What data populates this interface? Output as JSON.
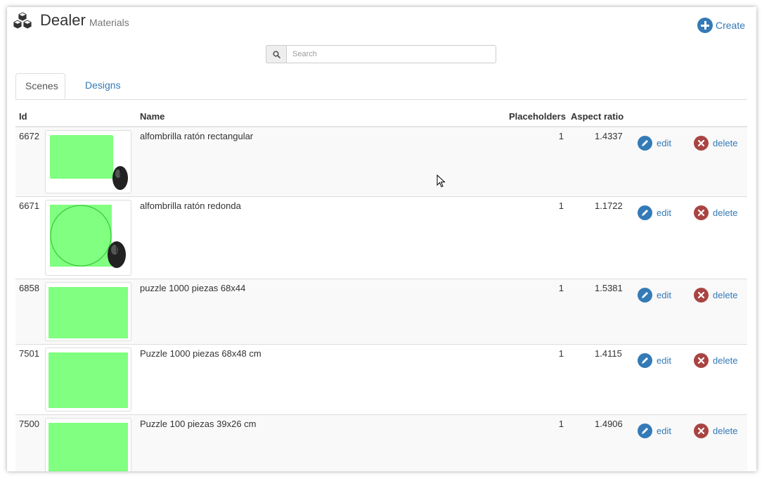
{
  "header": {
    "title": "Dealer",
    "subtitle": "Materials",
    "create_label": "Create"
  },
  "search": {
    "placeholder": "Search"
  },
  "tabs": [
    {
      "label": "Scenes",
      "active": true
    },
    {
      "label": "Designs",
      "active": false
    }
  ],
  "table": {
    "columns": {
      "id": "Id",
      "name": "Name",
      "placeholders": "Placeholders",
      "aspect_ratio": "Aspect ratio"
    },
    "edit_label": "edit",
    "delete_label": "delete",
    "rows": [
      {
        "id": "6672",
        "name": "alfombrilla ratón rectangular",
        "placeholders": "1",
        "aspect_ratio": "1.4337"
      },
      {
        "id": "6671",
        "name": "alfombrilla ratón redonda",
        "placeholders": "1",
        "aspect_ratio": "1.1722"
      },
      {
        "id": "6858",
        "name": "puzzle 1000 piezas 68x44",
        "placeholders": "1",
        "aspect_ratio": "1.5381"
      },
      {
        "id": "7501",
        "name": "Puzzle 1000 piezas 68x48 cm",
        "placeholders": "1",
        "aspect_ratio": "1.4115"
      },
      {
        "id": "7500",
        "name": "Puzzle 100 piezas 39x26 cm",
        "placeholders": "1",
        "aspect_ratio": "1.4906"
      }
    ]
  },
  "colors": {
    "link": "#337ab7",
    "danger": "#a94442",
    "placeholder_green": "#80ff80"
  }
}
